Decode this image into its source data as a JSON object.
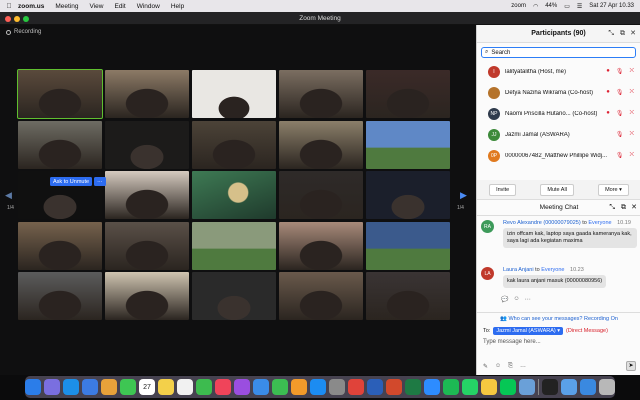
{
  "menubar": {
    "apple": "",
    "items": [
      "zoom.us",
      "Meeting",
      "View",
      "Edit",
      "Window",
      "Help"
    ],
    "status_right": [
      "zoom",
      "44%",
      "Sat 27 Apr  10.33"
    ]
  },
  "window": {
    "title": "Zoom Meeting"
  },
  "video": {
    "recording_label": "Recording",
    "page_left": "1/4",
    "page_right": "1/4",
    "ask_unmute_label": "Ask to Unmute",
    "more_dots": "···",
    "tiles": [
      {
        "kind": "room",
        "bg": "#5a4a3c",
        "active": true
      },
      {
        "kind": "room",
        "bg": "#8c7a66"
      },
      {
        "kind": "white",
        "bg": "#e9e7e3"
      },
      {
        "kind": "room",
        "bg": "#7b6e61"
      },
      {
        "kind": "room",
        "bg": "#3b2a28"
      },
      {
        "kind": "room",
        "bg": "#6e6c63"
      },
      {
        "kind": "dark",
        "bg": "#1c1b1a"
      },
      {
        "kind": "room",
        "bg": "#4c4338"
      },
      {
        "kind": "room",
        "bg": "#8b7f6a"
      },
      {
        "kind": "scene",
        "bg": "#5f88c6"
      },
      {
        "kind": "dark",
        "bg": "#101010"
      },
      {
        "kind": "room",
        "bg": "#d5cabf"
      },
      {
        "kind": "art",
        "bg": "#3e7a54"
      },
      {
        "kind": "room",
        "bg": "#2e2a29"
      },
      {
        "kind": "dark",
        "bg": "#1b1f2b"
      },
      {
        "kind": "room",
        "bg": "#76624d"
      },
      {
        "kind": "room",
        "bg": "#5a5048"
      },
      {
        "kind": "scene",
        "bg": "#8a9a7b"
      },
      {
        "kind": "room",
        "bg": "#a88a7a"
      },
      {
        "kind": "scene",
        "bg": "#3b5a8c"
      },
      {
        "kind": "room",
        "bg": "#5c5c5c"
      },
      {
        "kind": "room",
        "bg": "#cfc4b0"
      },
      {
        "kind": "dark",
        "bg": "#2a2a2a"
      },
      {
        "kind": "room",
        "bg": "#6a5a4c"
      },
      {
        "kind": "room",
        "bg": "#3a3434"
      }
    ]
  },
  "participants": {
    "header": "Participants (90)",
    "search_placeholder": "Search",
    "list": [
      {
        "initials": "I",
        "name": "lalityatalitha (Host, me)",
        "color": "#c0392b",
        "rec": true
      },
      {
        "initials": "",
        "name": "Detya Naziha Wikrama (Co-host)",
        "color": "#b5732b",
        "rec": true
      },
      {
        "initials": "NP",
        "name": "Naomi Priscilla Hutano... (Co-host)",
        "color": "#2f3b4c",
        "rec": true
      },
      {
        "initials": "JJ",
        "name": "Jazmi Jamal (ASWARA)",
        "color": "#3d8a3a",
        "rec": false
      },
      {
        "initials": "0P",
        "name": "00000067482_Matthew Phillipe Widj...",
        "color": "#e07a1f",
        "rec": false
      }
    ],
    "invite_label": "Invite",
    "mute_all_label": "Mute All",
    "more_label": "More"
  },
  "chat": {
    "header": "Meeting Chat",
    "messages": [
      {
        "initials": "RA",
        "color": "#3d9a5a",
        "from": "Revo Alexandre (00000079025)",
        "to_label": "to",
        "recipient": "Everyone",
        "recipient_note": "K to Every...",
        "time": "10.19",
        "text": "izin offcam kak, laptop saya gaada kameranya kak, saya lagi ada kegiatan maxima"
      },
      {
        "initials": "LA",
        "color": "#c0392b",
        "from": "Laura Anjani",
        "to_label": "to",
        "recipient": "Everyone",
        "time": "10.23",
        "text": "kak laura anjani masuk (00000080956)"
      }
    ],
    "who_can_see": "Who can see your messages? Recording On",
    "to_label": "To:",
    "to_recipient": "Jazmi Jamal (ASWARA)",
    "direct_message": "(Direct Message)",
    "input_placeholder": "Type message here..."
  },
  "dock": {
    "icons": [
      {
        "name": "finder-icon",
        "color": "#2b7de9"
      },
      {
        "name": "launchpad-icon",
        "color": "#7a6fe0"
      },
      {
        "name": "safari-icon",
        "color": "#1c8fe8"
      },
      {
        "name": "mail-icon",
        "color": "#3c7be2"
      },
      {
        "name": "photos-icon",
        "color": "#e8a23a"
      },
      {
        "name": "messages-icon",
        "color": "#3ec653"
      },
      {
        "name": "calendar-icon",
        "color": "#ffffff"
      },
      {
        "name": "notes-icon",
        "color": "#f3d04a"
      },
      {
        "name": "reminders-icon",
        "color": "#f1f1f1"
      },
      {
        "name": "facetime-icon",
        "color": "#3dbb4f"
      },
      {
        "name": "music-icon",
        "color": "#f0445a"
      },
      {
        "name": "podcasts-icon",
        "color": "#9a4ee0"
      },
      {
        "name": "keynote-icon",
        "color": "#3a8ce8"
      },
      {
        "name": "numbers-icon",
        "color": "#3cbd52"
      },
      {
        "name": "pages-icon",
        "color": "#f29a2a"
      },
      {
        "name": "appstore-icon",
        "color": "#1c8cf2"
      },
      {
        "name": "settings-icon",
        "color": "#8a8a8a"
      },
      {
        "name": "chrome-icon",
        "color": "#e0433a"
      },
      {
        "name": "word-icon",
        "color": "#2b5fb8"
      },
      {
        "name": "powerpoint-icon",
        "color": "#d2492c"
      },
      {
        "name": "excel-icon",
        "color": "#1e7a44"
      },
      {
        "name": "zoom-icon",
        "color": "#2d8cff"
      },
      {
        "name": "spotify-icon",
        "color": "#1db954"
      },
      {
        "name": "whatsapp-icon",
        "color": "#25d366"
      },
      {
        "name": "notes2-icon",
        "color": "#f6c840"
      },
      {
        "name": "line-icon",
        "color": "#06c755"
      },
      {
        "name": "preview-icon",
        "color": "#6aa0d8"
      },
      {
        "name": "terminal-icon",
        "color": "#222222"
      },
      {
        "name": "folder-icon",
        "color": "#5aa0e8"
      },
      {
        "name": "downloads-icon",
        "color": "#3a89e0"
      },
      {
        "name": "trash-icon",
        "color": "#b8b8b8"
      }
    ],
    "calendar_day": "27"
  }
}
